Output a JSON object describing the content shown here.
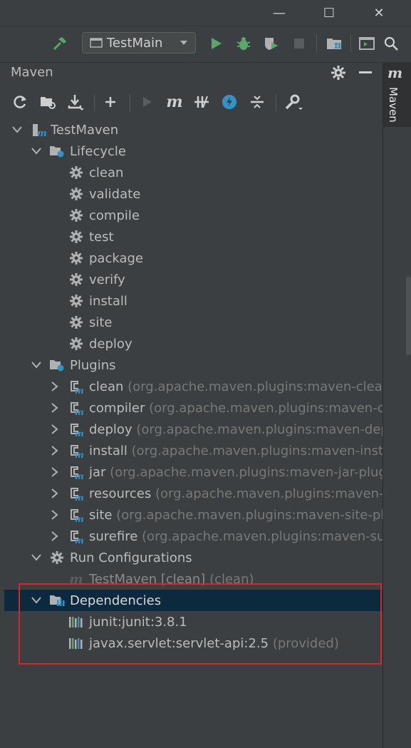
{
  "window": {
    "minimize_glyph": "—",
    "maximize_glyph": "☐",
    "close_glyph": "✕"
  },
  "toolbar": {
    "run_configuration": "TestMain",
    "icons": [
      "build-hammer-icon",
      "run-icon",
      "debug-icon",
      "coverage-icon",
      "stop-icon",
      "project-structure-icon",
      "terminal-icon",
      "search-icon"
    ]
  },
  "panel": {
    "title": "Maven",
    "toolbar_icons": [
      "reload-icon",
      "generate-sources-icon",
      "download-icon",
      "add-icon",
      "run-maven-build-icon",
      "execute-goal-icon",
      "toggle-offline-icon",
      "skip-tests-icon",
      "show-dependencies-icon",
      "collapse-all-icon",
      "settings-wrench-icon"
    ]
  },
  "right_strip": {
    "tab_label": "Maven",
    "tab_icon": "maven-m-icon"
  },
  "tree": {
    "project": "TestMaven",
    "lifecycle": {
      "label": "Lifecycle",
      "goals": [
        "clean",
        "validate",
        "compile",
        "test",
        "package",
        "verify",
        "install",
        "site",
        "deploy"
      ]
    },
    "plugins": {
      "label": "Plugins",
      "items": [
        {
          "name": "clean",
          "coords": "(org.apache.maven.plugins:maven-clean-p"
        },
        {
          "name": "compiler",
          "coords": "(org.apache.maven.plugins:maven-con"
        },
        {
          "name": "deploy",
          "coords": "(org.apache.maven.plugins:maven-deplo"
        },
        {
          "name": "install",
          "coords": "(org.apache.maven.plugins:maven-install-"
        },
        {
          "name": "jar",
          "coords": "(org.apache.maven.plugins:maven-jar-plugin"
        },
        {
          "name": "resources",
          "coords": "(org.apache.maven.plugins:maven-res"
        },
        {
          "name": "site",
          "coords": "(org.apache.maven.plugins:maven-site-plug"
        },
        {
          "name": "surefire",
          "coords": "(org.apache.maven.plugins:maven-suref"
        }
      ]
    },
    "run_configurations": {
      "label": "Run Configurations",
      "items": [
        {
          "name": "TestMaven [clean]",
          "detail": "(clean)"
        }
      ]
    },
    "dependencies": {
      "label": "Dependencies",
      "items": [
        {
          "name": "junit:junit:3.8.1",
          "detail": ""
        },
        {
          "name": "javax.servlet:servlet-api:2.5",
          "detail": "(provided)"
        }
      ]
    }
  },
  "colors": {
    "background": "#3c3f41",
    "selection": "#0d293e",
    "highlight_box": "#d1282f",
    "run_green": "#59a869",
    "maven_blue": "#3592c4"
  }
}
